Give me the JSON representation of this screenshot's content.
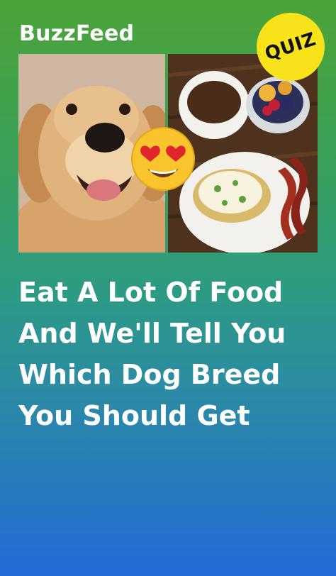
{
  "header": {
    "brand": "BuzzFeed",
    "badge": "QUIZ"
  },
  "images": {
    "left": {
      "subject": "golden retriever dog",
      "icon": "dog-photo"
    },
    "right": {
      "subject": "breakfast with coffee, fruit bowl, eggs on toast and bacon",
      "icon": "food-photo"
    },
    "overlay_icon": "heart-eyes-emoji"
  },
  "headline": {
    "lines": [
      "Eat A Lot Of Food",
      "And We'll Tell You",
      "Which Dog Breed",
      "You Should Get"
    ]
  },
  "colors": {
    "gradient_top": "#4ca438",
    "gradient_bottom": "#246ad8",
    "badge_yellow": "#f8e31a",
    "text": "#ffffff"
  }
}
